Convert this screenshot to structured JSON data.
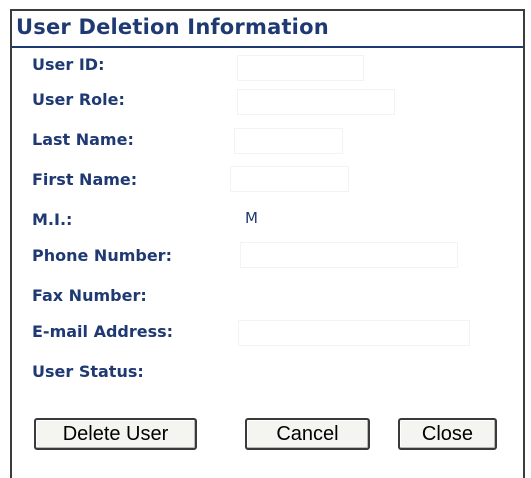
{
  "section": {
    "title": "User Deletion Information"
  },
  "fields": {
    "user_id": {
      "label": "User ID:",
      "value": ""
    },
    "user_role": {
      "label": "User Role:",
      "value": ""
    },
    "last_name": {
      "label": "Last Name:",
      "value": ""
    },
    "first_name": {
      "label": "First Name:",
      "value": ""
    },
    "middle_initial": {
      "label": "M.I.:",
      "value": "M"
    },
    "phone_number": {
      "label": "Phone Number:",
      "value": ""
    },
    "fax_number": {
      "label": "Fax Number:",
      "value": ""
    },
    "email_address": {
      "label": "E-mail Address:",
      "value": ""
    },
    "user_status": {
      "label": "User Status:",
      "value": ""
    }
  },
  "buttons": {
    "delete_label": "Delete User",
    "cancel_label": "Cancel",
    "close_label": "Close"
  }
}
